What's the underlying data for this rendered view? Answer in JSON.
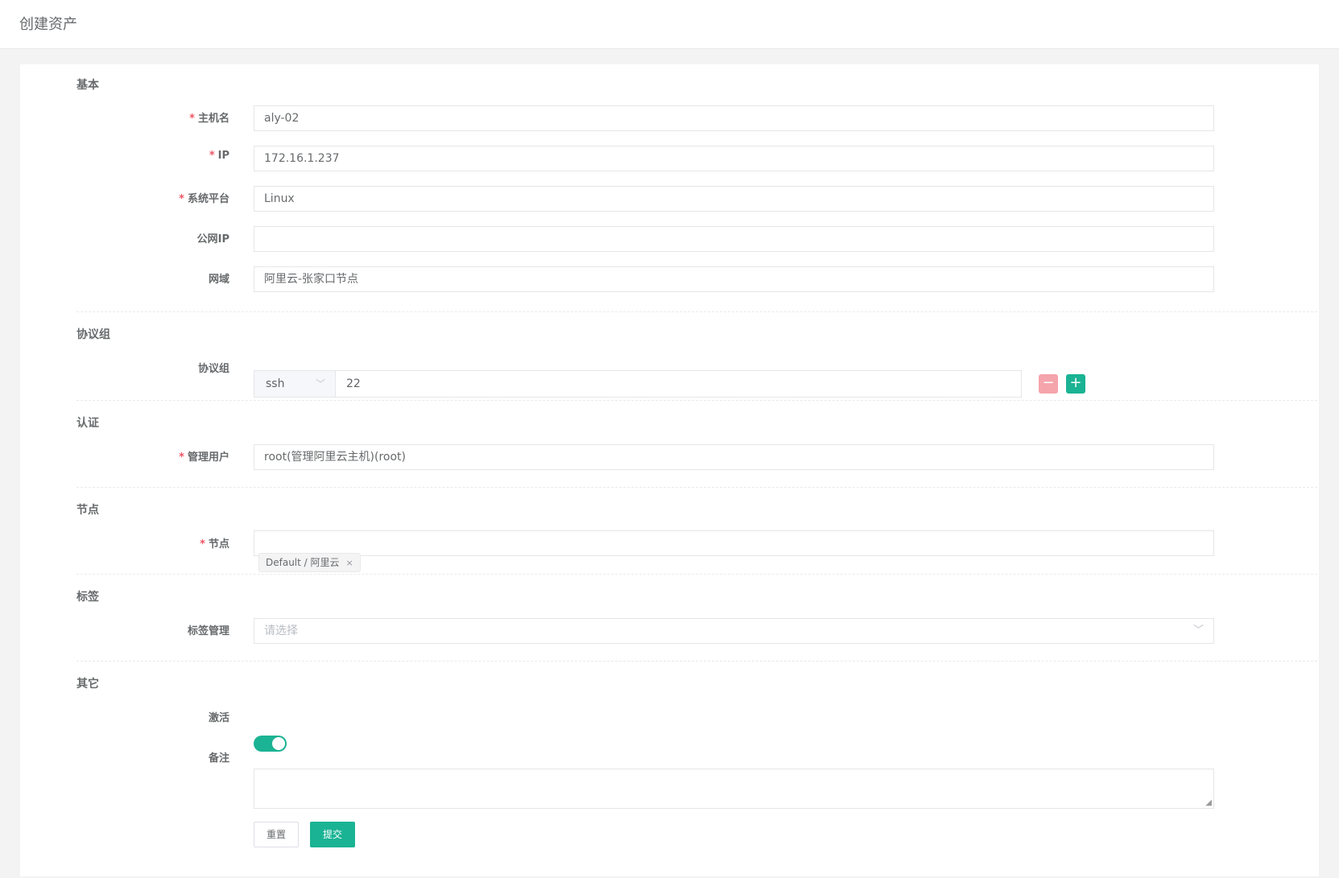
{
  "header": {
    "title": "创建资产"
  },
  "sections": {
    "basic": "基本",
    "protocols": "协议组",
    "auth": "认证",
    "nodes": "节点",
    "labels": "标签",
    "other": "其它"
  },
  "required_mark": "*",
  "fields": {
    "hostname": {
      "label": "主机名",
      "value": "aly-02"
    },
    "ip": {
      "label": "IP",
      "value": "172.16.1.237"
    },
    "platform": {
      "label": "系统平台",
      "value": "Linux"
    },
    "public_ip": {
      "label": "公网IP",
      "value": ""
    },
    "domain": {
      "label": "网域",
      "value": "阿里云-张家口节点"
    },
    "protocols": {
      "label": "协议组",
      "protocol": "ssh",
      "port": "22",
      "remove_icon": "minus-icon",
      "add_icon": "plus-icon"
    },
    "admin_user": {
      "label": "管理用户",
      "value": "root(管理阿里云主机)(root)"
    },
    "nodes": {
      "label": "节点",
      "tags": [
        "Default / 阿里云"
      ],
      "tag_close": "×"
    },
    "labels": {
      "label": "标签管理",
      "placeholder": "请选择"
    },
    "active": {
      "label": "激活",
      "value": true
    },
    "comment": {
      "label": "备注",
      "value": ""
    }
  },
  "actions": {
    "reset_label": "重置",
    "submit_label": "提交"
  },
  "colors": {
    "accent": "#1ab394",
    "danger": "#ed5565",
    "danger_light": "#f5a4ac"
  }
}
